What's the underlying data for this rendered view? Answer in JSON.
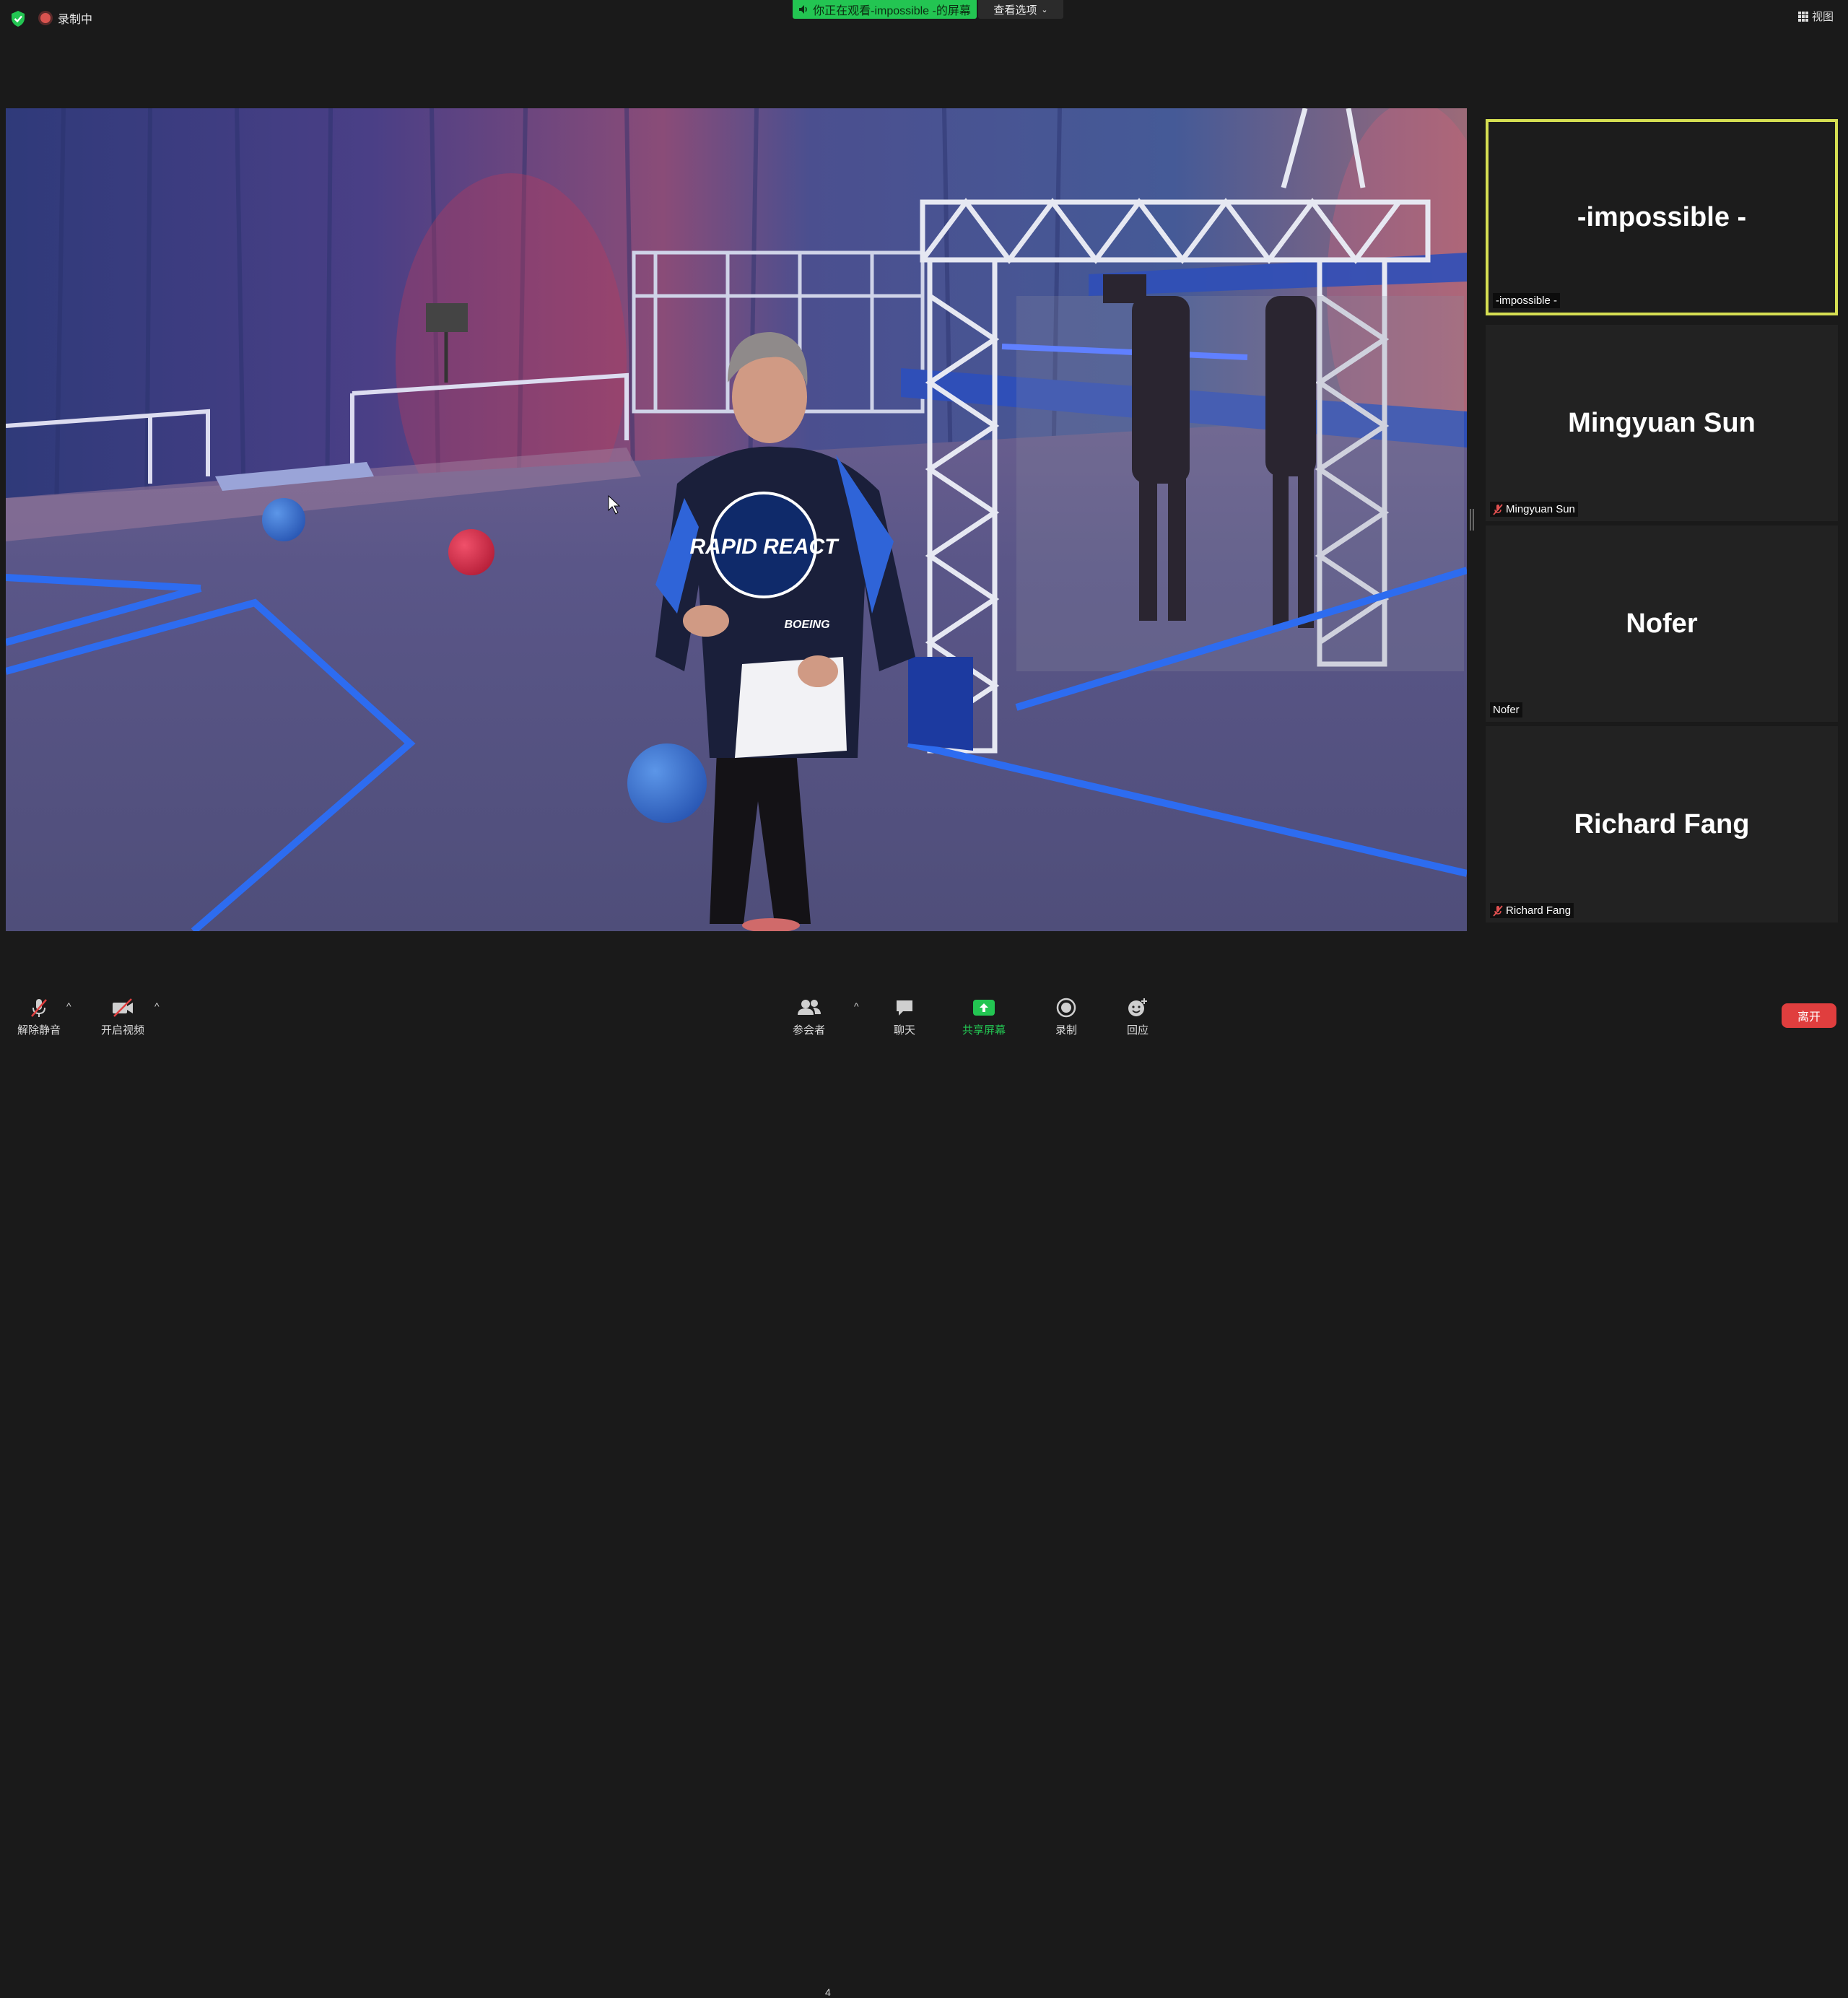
{
  "topbar": {
    "recording_label": "录制中",
    "viewing_label": "你正在观看-impossible -的屏幕",
    "view_options_label": "查看选项",
    "view_label": "视图"
  },
  "participants": [
    {
      "display": "-impossible -",
      "label": "-impossible -",
      "muted": false,
      "active": true
    },
    {
      "display": "Mingyuan Sun",
      "label": "Mingyuan Sun",
      "muted": true,
      "active": false
    },
    {
      "display": "Nofer",
      "label": "Nofer",
      "muted": false,
      "active": false
    },
    {
      "display": "Richard Fang",
      "label": "Richard Fang",
      "muted": true,
      "active": false
    }
  ],
  "shared_screen": {
    "jersey_text": "RAPID REACT",
    "sponsor_text": "BOEING"
  },
  "toolbar": {
    "unmute_label": "解除静音",
    "start_video_label": "开启视频",
    "participants_label": "参会者",
    "participants_count": "4",
    "chat_label": "聊天",
    "share_screen_label": "共享屏幕",
    "record_label": "录制",
    "reactions_label": "回应",
    "leave_label": "离开"
  },
  "colors": {
    "active_speaker_border": "#d5de52",
    "share_green": "#23c552",
    "leave_red": "#e03e3e"
  }
}
